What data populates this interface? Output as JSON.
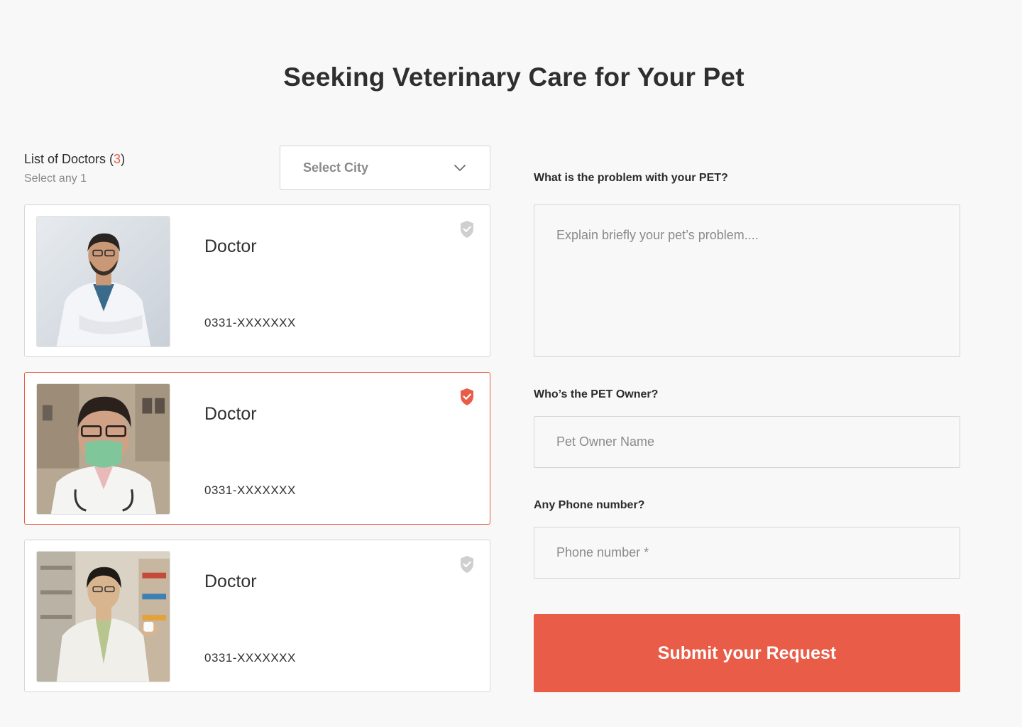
{
  "page": {
    "title": "Seeking Veterinary Care for Your Pet"
  },
  "doctors_list": {
    "title_prefix": "List of Doctors (",
    "count": "3",
    "title_suffix": ")",
    "subtitle": "Select any 1",
    "city_select": {
      "selected": "Select City"
    },
    "doctors": [
      {
        "name": "Doctor",
        "phone": "0331-XXXXXXX",
        "selected": false,
        "icon": "shield-check-icon"
      },
      {
        "name": "Doctor",
        "phone": "0331-XXXXXXX",
        "selected": true,
        "icon": "shield-check-icon"
      },
      {
        "name": "Doctor",
        "phone": "0331-XXXXXXX",
        "selected": false,
        "icon": "shield-check-icon"
      }
    ]
  },
  "form": {
    "problem_label": "What is the problem with your PET?",
    "problem_placeholder": "Explain briefly your pet’s problem....",
    "problem_value": "",
    "owner_label": "Who’s the PET Owner?",
    "owner_placeholder": "Pet Owner Name",
    "owner_value": "",
    "phone_label": "Any Phone number?",
    "phone_placeholder": "Phone number *",
    "phone_value": "",
    "submit_label": "Submit your Request"
  },
  "colors": {
    "accent": "#e85c48",
    "shield_inactive": "#cfcfcf",
    "text": "#2b2b2b",
    "muted": "#8a8a8a"
  }
}
